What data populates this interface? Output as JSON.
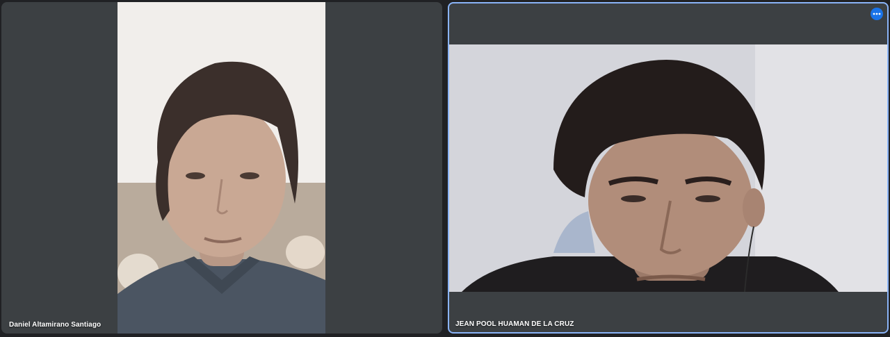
{
  "participants": [
    {
      "name": "Daniel Altamirano Santiago",
      "pinned": false
    },
    {
      "name": "JEAN POOL HUAMAN DE LA CRUZ",
      "pinned": false,
      "more_options_icon": "more-horizontal-icon",
      "active_speaker": true
    }
  ],
  "colors": {
    "background": "#202124",
    "tile": "#3c4043",
    "active_border": "#8ab4f8",
    "accent": "#1a73e8"
  }
}
